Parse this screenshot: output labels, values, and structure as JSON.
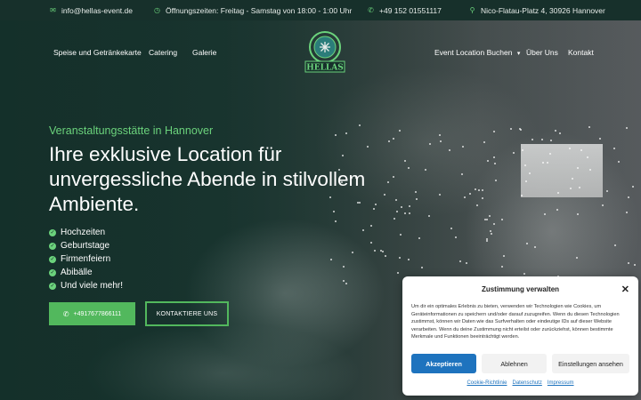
{
  "topbar": {
    "email": "info@hellas-event.de",
    "hours": "Öffnungszeiten: Freitag - Samstag von 18:00 - 1:00 Uhr",
    "phone": "+49 152 01551117",
    "address": "Nico-Flatau-Platz 4, 30926 Hannover"
  },
  "nav": {
    "left": [
      "Speise und Getränkekarte",
      "Catering",
      "Galerie"
    ],
    "right": [
      "Event Location Buchen",
      "Über Uns",
      "Kontakt"
    ],
    "logo_text": "HELLAS"
  },
  "hero": {
    "eyebrow": "Veranstaltungsstätte in Hannover",
    "headline": "Ihre exklusive Location für unvergessliche Abende in stilvollem Ambiente.",
    "features": [
      "Hochzeiten",
      "Geburtstage",
      "Firmenfeiern",
      "Abibälle",
      "Und viele mehr!"
    ],
    "phone_button": "+4917677866111",
    "contact_button": "KONTAKTIERE UNS"
  },
  "cookie": {
    "title": "Zustimmung verwalten",
    "text": "Um dir ein optimales Erlebnis zu bieten, verwenden wir Technologien wie Cookies, um Geräteinformationen zu speichern und/oder darauf zuzugreifen. Wenn du diesen Technologien zustimmst, können wir Daten wie das Surfverhalten oder eindeutige IDs auf dieser Website verarbeiten. Wenn du deine Zustimmung nicht erteilst oder zurückziehst, können bestimmte Merkmale und Funktionen beeinträchtigt werden.",
    "accept": "Akzeptieren",
    "deny": "Ablehnen",
    "settings": "Einstellungen ansehen",
    "links": [
      "Cookie-Richtlinie",
      "Datenschutz",
      "Impressum"
    ]
  },
  "colors": {
    "brand_green": "#52b85d",
    "accent_green": "#6bd37c",
    "dark_green": "#17302b",
    "cookie_blue": "#1e73be"
  }
}
